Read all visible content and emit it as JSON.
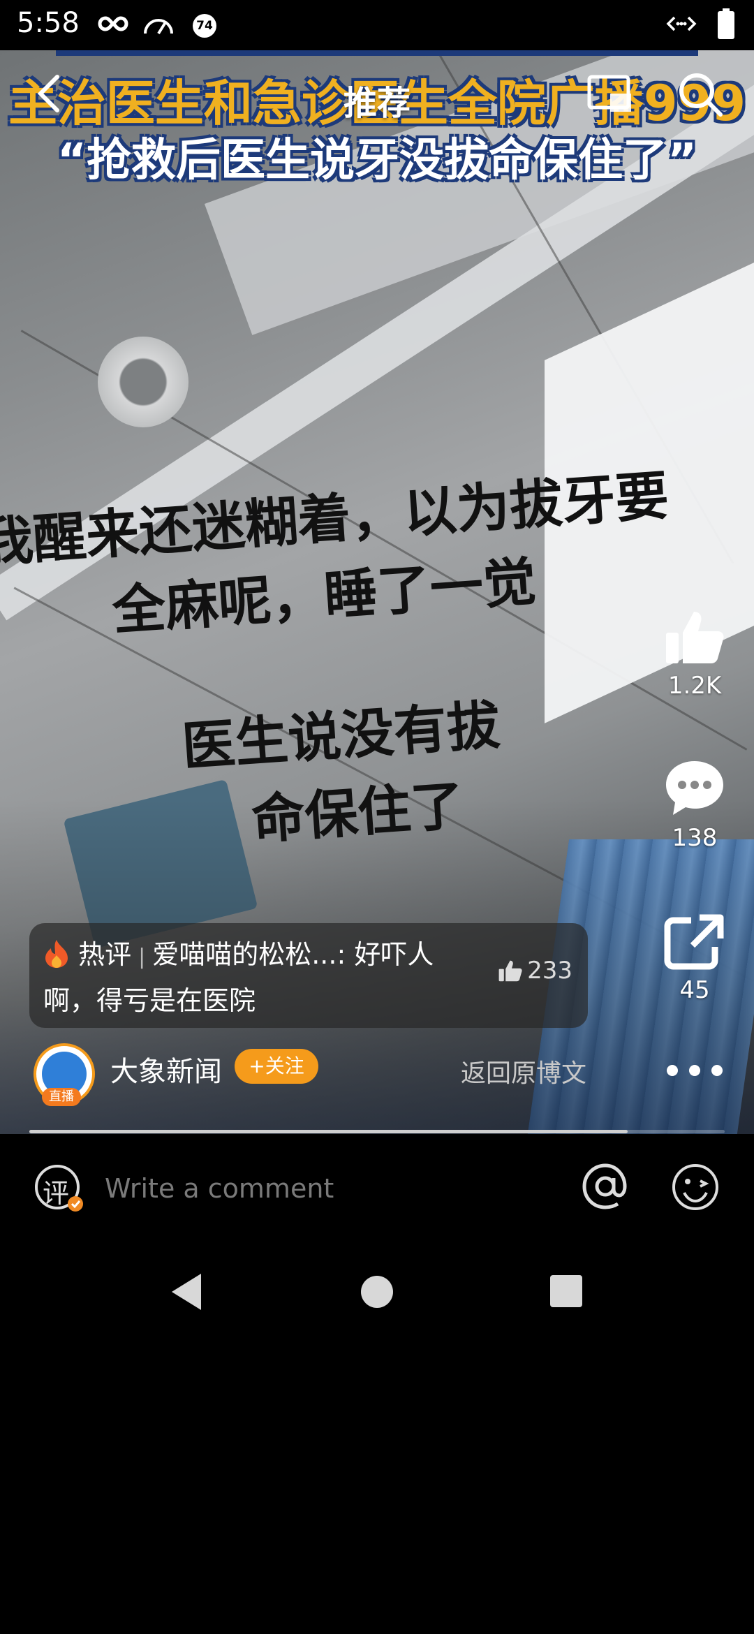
{
  "status_bar": {
    "time": "5:58",
    "badge_number": "74"
  },
  "video": {
    "headline_line1": "主治医生和急诊医生全院广播999",
    "headline_line2": "“抢救后医生说牙没拔命保住了”",
    "captions": [
      "我醒来还迷糊着，以为拔牙要",
      "全麻呢，睡了一觉",
      "医生说没有拔",
      "命保住了"
    ],
    "watermark": "大象\n新闻"
  },
  "top_nav": {
    "title": "推荐"
  },
  "actions": {
    "likes": "1.2K",
    "comments": "138",
    "shares": "45"
  },
  "hot_comment": {
    "tag": "热评",
    "user": "爱喵喵的松松...",
    "text_part1": ": 好吓人",
    "text_part2": "啊，得亏是在医院",
    "likes": "233"
  },
  "author": {
    "name": "大象新闻",
    "follow_label": "+关注",
    "live_badge": "直播",
    "back_to_post": "返回原博文"
  },
  "progress": {
    "fraction": 0.86
  },
  "comment_bar": {
    "placeholder": "Write a comment",
    "icon_char": "评"
  },
  "colors": {
    "accent": "#f59b1b",
    "headline_blue": "#1d3a7a",
    "headline_gold": "#f0b020"
  }
}
